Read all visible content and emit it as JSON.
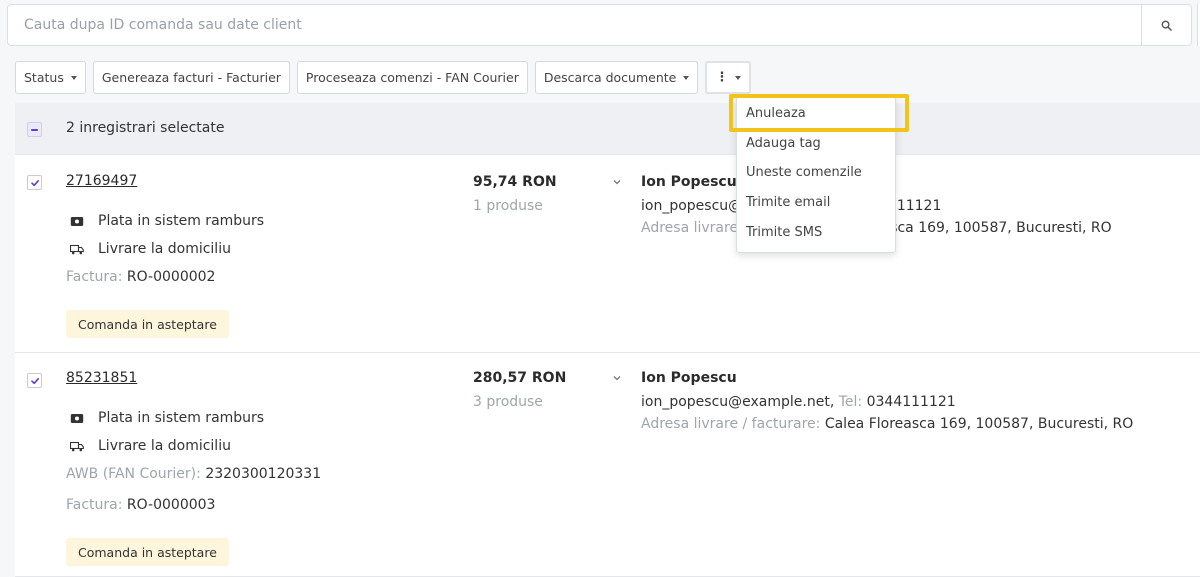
{
  "search": {
    "placeholder": "Cauta dupa ID comanda sau date client",
    "value": ""
  },
  "toolbar": {
    "status_label": "Status",
    "invoices_label": "Genereaza facturi - Facturier",
    "process_label": "Proceseaza comenzi - FAN Courier",
    "documents_label": "Descarca documente",
    "more_label": "⋮"
  },
  "selection": {
    "text": "2 inregistrari selectate"
  },
  "orders": [
    {
      "id": "27169497",
      "payment": "Plata in sistem ramburs",
      "shipping": "Livrare la domiciliu",
      "invoice_label": "Factura:",
      "invoice": "RO-0000002",
      "status": "Comanda in asteptare",
      "price": "95,74 RON",
      "products": "1 produse",
      "customer_name": "Ion Popescu",
      "email": "ion_popescu@",
      "phone_fragment": "4111121",
      "address_label": "Adresa livrare",
      "address_fragment": "easca 169, 100587, Bucuresti, RO"
    },
    {
      "id": "85231851",
      "payment": "Plata in sistem ramburs",
      "shipping": "Livrare la domiciliu",
      "awb_label": "AWB (FAN Courier):",
      "awb": "2320300120331",
      "invoice_label": "Factura:",
      "invoice": "RO-0000003",
      "status": "Comanda in asteptare",
      "price": "280,57 RON",
      "products": "3 produse",
      "customer_name": "Ion Popescu",
      "email": "ion_popescu@example.net,",
      "phone_label": "Tel:",
      "phone": "0344111121",
      "address_label": "Adresa livrare / facturare:",
      "address": "Calea Floreasca 169, 100587, Bucuresti, RO"
    }
  ],
  "dropdown": {
    "items": [
      "Anuleaza",
      "Adauga tag",
      "Uneste comenzile",
      "Trimite email",
      "Trimite SMS"
    ],
    "highlighted": "Anuleaza"
  },
  "colors": {
    "accent": "#5b3fd8",
    "highlight": "#f2c31b",
    "badge_bg": "#fdf5dc"
  },
  "icons": [
    "search-icon",
    "chevron-down-icon",
    "cash-icon",
    "truck-icon",
    "checkbox-checked-icon",
    "checkbox-indeterminate-icon",
    "vertical-dots-icon"
  ]
}
